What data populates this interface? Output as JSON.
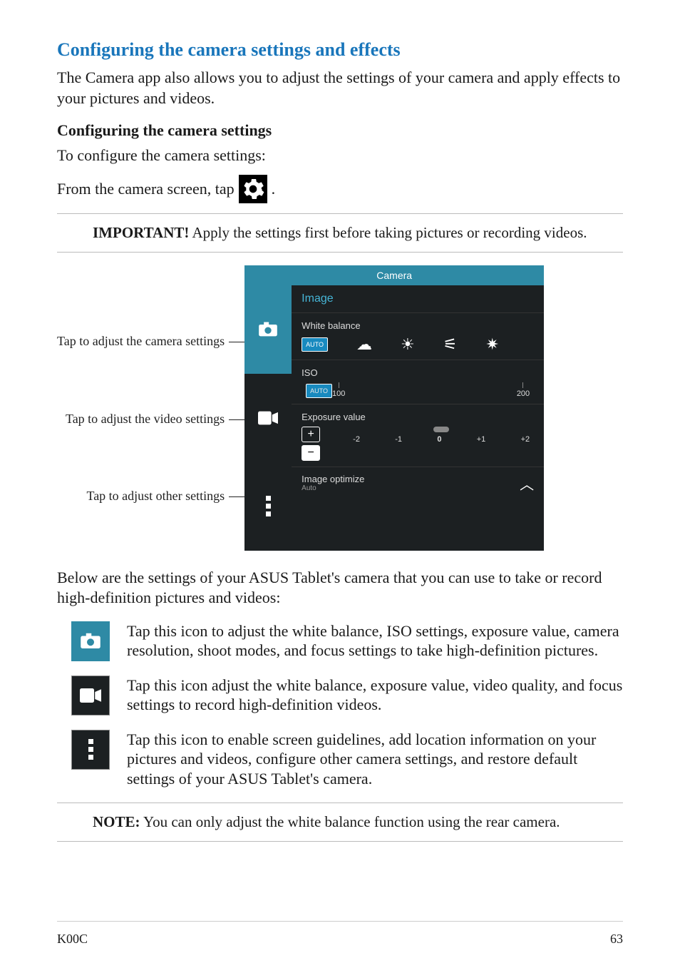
{
  "section_title": "Configuring the camera settings and effects",
  "intro": "The Camera app also allows you to adjust the settings of your camera and apply effects to your pictures and videos.",
  "sub_heading": "Configuring the camera settings",
  "to_configure": "To configure the camera settings:",
  "from_screen": "From the camera screen, tap",
  "period": ".",
  "important_lead": "IMPORTANT!",
  "important_body": "Apply the settings first before taking pictures or recording videos.",
  "labels": {
    "camera": "Tap to adjust the camera settings",
    "video": "Tap to adjust the video settings",
    "other": "Tap to adjust other settings"
  },
  "screenshot": {
    "header": "Camera",
    "image_tab": "Image",
    "wb_label": "White balance",
    "wb_auto": "AUTO",
    "iso_label": "ISO",
    "iso_auto": "AUTO",
    "iso_100": "100",
    "iso_200": "200",
    "ev_label": "Exposure value",
    "ev_m2": "-2",
    "ev_m1": "-1",
    "ev_0": "0",
    "ev_p1": "+1",
    "ev_p2": "+2",
    "optimize": "Image optimize",
    "optimize_sub": "Auto"
  },
  "below_text": "Below are the settings of your ASUS Tablet's camera that you can use to take or record high-definition pictures and videos:",
  "table": {
    "camera": "Tap this icon to adjust the white balance, ISO settings, exposure value, camera resolution, shoot modes, and focus settings to take high-definition pictures.",
    "video": "Tap this icon adjust the white balance, exposure value, video quality, and focus settings to record high-definition videos.",
    "other": "Tap this icon to enable screen guidelines, add location information on your pictures and videos, configure other camera settings, and restore default settings of your ASUS Tablet's camera."
  },
  "note_lead": "NOTE:",
  "note_body": "You can only adjust the white balance function using the rear camera.",
  "footer_left": "K00C",
  "footer_right": "63"
}
